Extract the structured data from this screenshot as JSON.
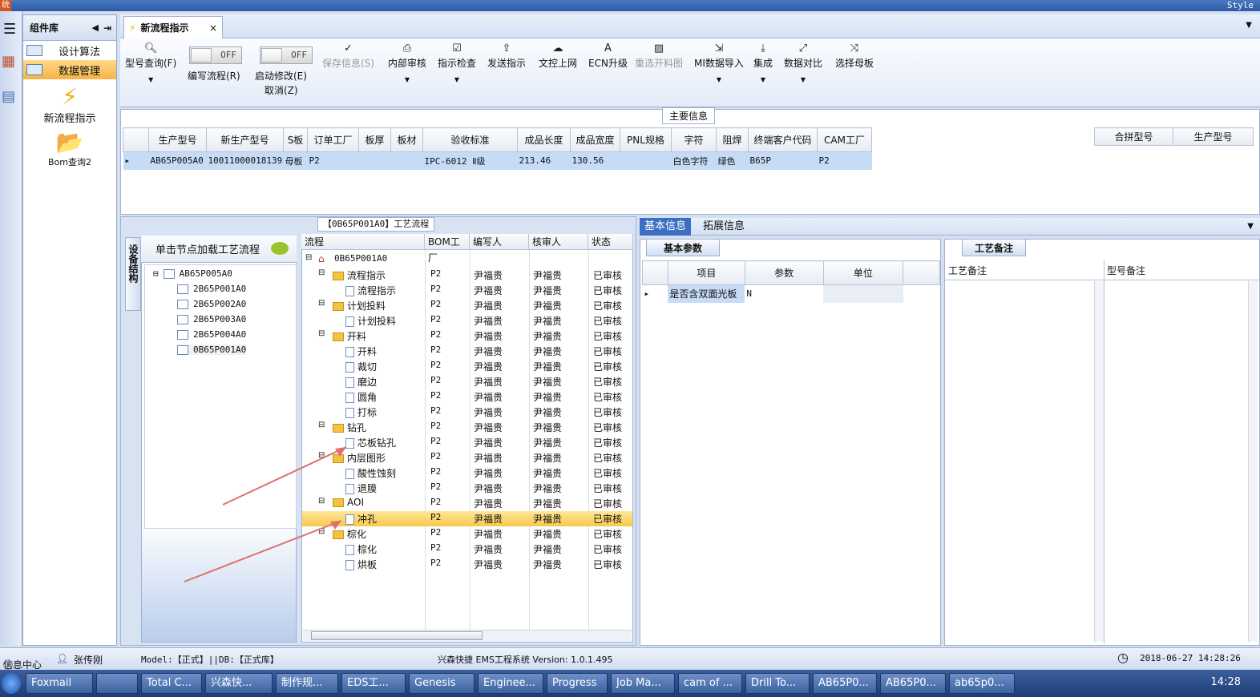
{
  "app": {
    "title_initial": "统",
    "style_label": "Style"
  },
  "component_panel": {
    "title": "组件库",
    "items": [
      {
        "label": "设计算法",
        "selected": false
      },
      {
        "label": "数据管理",
        "selected": true
      }
    ],
    "big_items": [
      {
        "label": "新流程指示",
        "icon": "lightning-icon"
      },
      {
        "label": "Bom查询2",
        "icon": "folder-open-icon"
      }
    ]
  },
  "tabs": [
    {
      "label": "新流程指示"
    }
  ],
  "toolbar": {
    "model_query": "型号查询(F)",
    "toggle_off": "OFF",
    "write_flow": "编写流程(R)",
    "start_modify": "启动修改(E)",
    "cancel": "取消(Z)",
    "save_info": "保存信息(S)",
    "internal_review": "内部审核",
    "instruction_check": "指示检查",
    "send_instruction": "发送指示",
    "doc_upload": "文控上网",
    "ecn_upgrade": "ECN升级",
    "reselect_cutting": "重选开料图",
    "mi_import": "MI数据导入",
    "integrate": "集成",
    "data_compare": "数据对比",
    "select_parent": "选择母板"
  },
  "main_info": {
    "label": "主要信息",
    "columns": [
      "生产型号",
      "新生产型号",
      "S板",
      "订单工厂",
      "板厚",
      "板材",
      "验收标准",
      "成品长度",
      "成品宽度",
      "PNL规格",
      "字符",
      "阻焊",
      "终端客户代码",
      "CAM工厂"
    ],
    "row": [
      "AB65P005A0",
      "10011000018139",
      "母板",
      "P2",
      "",
      "",
      "IPC-6012 Ⅱ级",
      "213.46",
      "130.56",
      "",
      "白色字符",
      "绿色",
      "B65P",
      "P2"
    ],
    "merge_columns": [
      "合拼型号",
      "生产型号"
    ]
  },
  "flow_panel": {
    "label": "【0B65P001A0】工艺流程",
    "device_tab": "设备结构",
    "hint": "单击节点加载工艺流程",
    "device_tree": [
      "AB65P005A0",
      "2B65P001A0",
      "2B65P002A0",
      "2B65P003A0",
      "2B65P004A0",
      "0B65P001A0"
    ],
    "grid_columns": [
      "流程",
      "BOM工厂",
      "编写人",
      "核审人",
      "状态"
    ],
    "root": "0B65P001A0",
    "rows": [
      {
        "name": "流程指示",
        "level": 1,
        "folder": true
      },
      {
        "name": "流程指示",
        "level": 2,
        "folder": false
      },
      {
        "name": "计划投料",
        "level": 1,
        "folder": true
      },
      {
        "name": "计划投料",
        "level": 2,
        "folder": false
      },
      {
        "name": "开料",
        "level": 1,
        "folder": true
      },
      {
        "name": "开料",
        "level": 2,
        "folder": false
      },
      {
        "name": "裁切",
        "level": 2,
        "folder": false
      },
      {
        "name": "磨边",
        "level": 2,
        "folder": false
      },
      {
        "name": "圆角",
        "level": 2,
        "folder": false
      },
      {
        "name": "打标",
        "level": 2,
        "folder": false
      },
      {
        "name": "钻孔",
        "level": 1,
        "folder": true
      },
      {
        "name": "芯板钻孔",
        "level": 2,
        "folder": false
      },
      {
        "name": "内层图形",
        "level": 1,
        "folder": true
      },
      {
        "name": "酸性蚀刻",
        "level": 2,
        "folder": false
      },
      {
        "name": "退膜",
        "level": 2,
        "folder": false
      },
      {
        "name": "AOI",
        "level": 1,
        "folder": true
      },
      {
        "name": "冲孔",
        "level": 2,
        "folder": false,
        "selected": true
      },
      {
        "name": "棕化",
        "level": 1,
        "folder": true
      },
      {
        "name": "棕化",
        "level": 2,
        "folder": false
      },
      {
        "name": "烘板",
        "level": 2,
        "folder": false
      }
    ],
    "bom_factory": "P2",
    "writer": "尹福贵",
    "reviewer": "尹福贵",
    "status": "已审核"
  },
  "right_panel": {
    "tabs": [
      "基本信息",
      "拓展信息"
    ],
    "basic_tab": "基本参数",
    "basic_columns": [
      "项目",
      "参数",
      "单位"
    ],
    "basic_row": [
      "是否含双面光板",
      "N",
      ""
    ],
    "remark_tab": "工艺备注",
    "remark_columns": [
      "工艺备注",
      "型号备注"
    ]
  },
  "status_bar": {
    "info_center": "信息中心",
    "user": "张传刚",
    "model_db": "Model:【正式】||DB:【正式库】",
    "system": "兴森快捷 EMS工程系统 Version: 1.0.1.495",
    "datetime": "2018-06-27 14:28:26"
  },
  "taskbar": {
    "items": [
      "Foxmail",
      "",
      "Total C...",
      "兴森快...",
      "制作规...",
      "EDS工...",
      "Genesis",
      "Enginee...",
      "Progress",
      "Job Ma...",
      "cam of ...",
      "Drill To...",
      "AB65P0...",
      "AB65P0...",
      "ab65p0..."
    ],
    "clock": "14:28"
  }
}
